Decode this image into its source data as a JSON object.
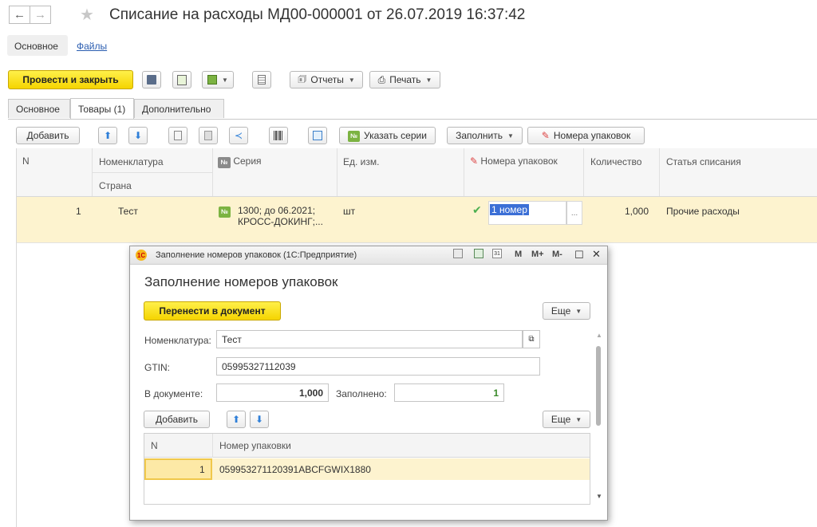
{
  "window": {
    "title": "Списание на расходы МД00-000001 от 26.07.2019 16:37:42"
  },
  "top_links": {
    "main": "Основное",
    "files": "Файлы"
  },
  "toolbar": {
    "post_close": "Провести и закрыть",
    "reports": "Отчеты",
    "print": "Печать"
  },
  "tabs": [
    {
      "label": "Основное"
    },
    {
      "label": "Товары (1)"
    },
    {
      "label": "Дополнительно"
    }
  ],
  "goods_toolbar": {
    "add": "Добавить",
    "series": "Указать серии",
    "fill": "Заполнить",
    "pack_numbers": "Номера упаковок"
  },
  "goods_table": {
    "headers": {
      "n": "N",
      "nomenclature": "Номенклатура",
      "country": "Страна",
      "series": "Серия",
      "unit": "Ед. изм.",
      "packages": "Номера упаковок",
      "quantity": "Количество",
      "article": "Статья списания"
    },
    "rows": [
      {
        "n": "1",
        "nomenclature": "Тест",
        "series_line1": "1300; до 06.2021;",
        "series_line2": "КРОСС-ДОКИНГ;...",
        "unit": "шт",
        "packages": "1 номер",
        "quantity": "1,000",
        "article": "Прочие расходы"
      }
    ]
  },
  "dialog": {
    "window_title": "Заполнение номеров упаковок (1С:Предприятие)",
    "heading": "Заполнение номеров упаковок",
    "transfer_btn": "Перенести в документ",
    "more": "Еще",
    "label_nomenclature": "Номенклатура:",
    "value_nomenclature": "Тест",
    "label_gtin": "GTIN:",
    "value_gtin": "05995327112039",
    "label_in_doc": "В документе:",
    "value_in_doc": "1,000",
    "label_filled": "Заполнено:",
    "value_filled": "1",
    "add_btn": "Добавить",
    "more2": "Еще",
    "title_btns": {
      "m": "M",
      "mplus": "M+",
      "mminus": "M-"
    },
    "table": {
      "headers": {
        "n": "N",
        "pack": "Номер упаковки"
      },
      "rows": [
        {
          "n": "1",
          "pack": "059953271120391ABCFGWIX1880"
        }
      ]
    }
  },
  "colors": {
    "accent_yellow": "#f5d400",
    "row_highlight": "#fdf3cf",
    "selection_blue": "#3b6fd6",
    "check_green": "#4caf50"
  }
}
